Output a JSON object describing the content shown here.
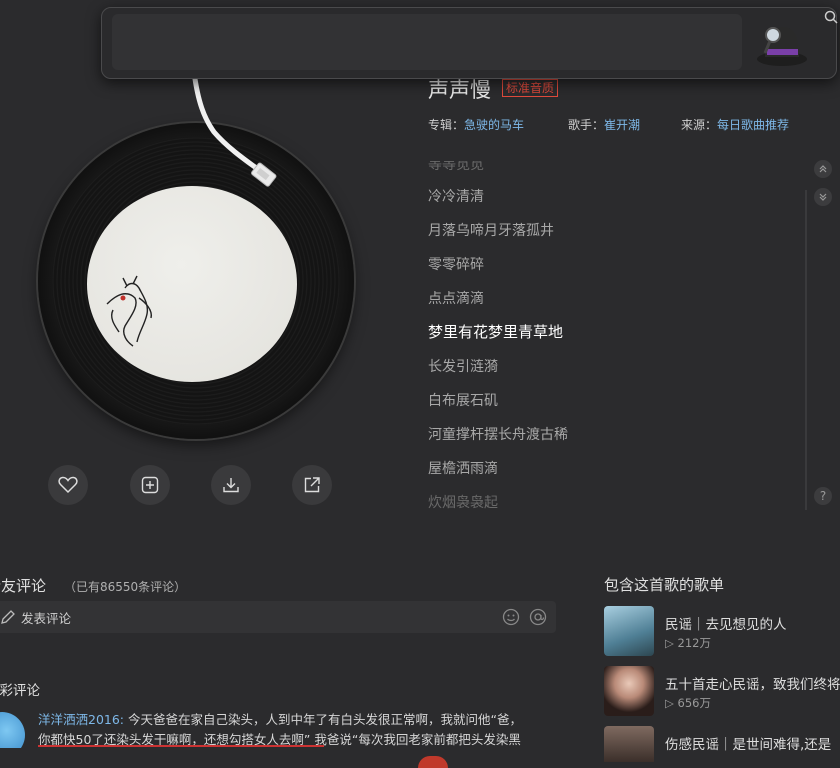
{
  "song": {
    "title": "声声慢",
    "quality_badge": "标准音质",
    "album_label": "专辑：",
    "album": "急驶的马车",
    "artist_label": "歌手：",
    "artist": "崔开潮",
    "source_label": "来源：",
    "source": "每日歌曲推荐"
  },
  "lyrics": [
    {
      "text": "等等觅觅",
      "state": "fade"
    },
    {
      "text": "冷冷清清",
      "state": "normal"
    },
    {
      "text": "月落乌啼月牙落孤井",
      "state": "normal"
    },
    {
      "text": "零零碎碎",
      "state": "normal"
    },
    {
      "text": "点点滴滴",
      "state": "normal"
    },
    {
      "text": "梦里有花梦里青草地",
      "state": "active"
    },
    {
      "text": "长发引涟漪",
      "state": "normal"
    },
    {
      "text": "白布展石矶",
      "state": "normal"
    },
    {
      "text": "河童撑杆摆长舟渡古稀",
      "state": "normal"
    },
    {
      "text": "屋檐洒雨滴",
      "state": "normal"
    },
    {
      "text": "炊烟袅袅起",
      "state": "fade"
    }
  ],
  "actions": [
    "like-icon",
    "add-to-playlist-icon",
    "download-icon",
    "share-icon"
  ],
  "comments": {
    "title": "听友评论",
    "count_text": "（已有86550条评论）",
    "input_placeholder": "发表评论",
    "featured_title": "精彩评论",
    "first": {
      "user": "洋洋洒洒2016:",
      "line1": " 今天爸爸在家自己染头，人到中年了有白头发很正常啊，我就问他“爸，",
      "line2": "你都快50了还染头发干嘛啊，还想勾搭女人去啊” 我爸说“每次我回老家前都把头发染黑"
    }
  },
  "playlists": {
    "title": "包含这首歌的歌单",
    "items": [
      {
        "name": "民谣｜去见想见的人",
        "plays": "▷ 212万"
      },
      {
        "name": "五十首走心民谣，致我们终将",
        "plays": "▷ 656万"
      },
      {
        "name": "伤感民谣｜是世间难得,还是",
        "plays": ""
      }
    ]
  },
  "colors": {
    "background": "#2b2b2d",
    "link": "#7eb8e8",
    "quality_badge": "#e04a3c"
  }
}
